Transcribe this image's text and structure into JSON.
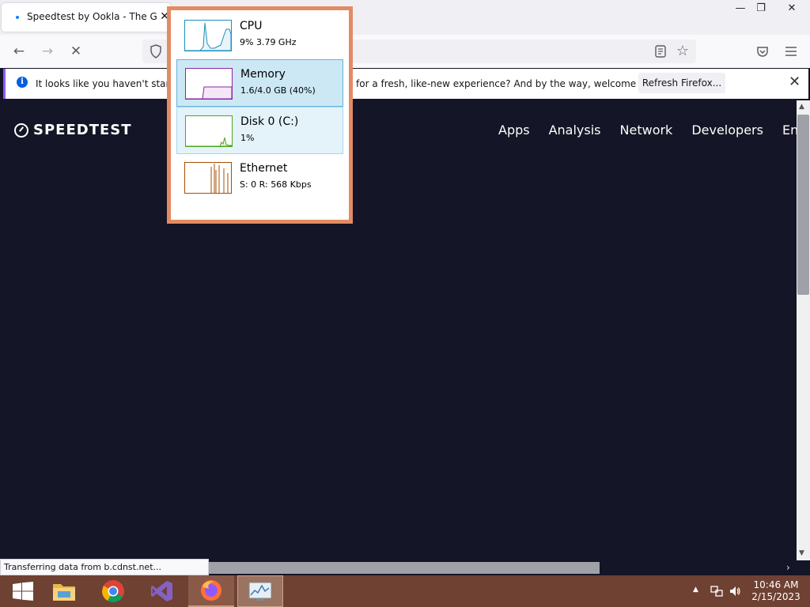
{
  "browser": {
    "tab": {
      "title": "Speedtest by Ookla - The Global Broadband Speed Test"
    },
    "notification": {
      "text_left": "It looks like you haven't started",
      "text_right": "for a fresh, like-new experience? And by the way, welcome back!",
      "button_label": "Refresh Firefox..."
    },
    "status_text": "Transferring data from b.cdnst.net..."
  },
  "site": {
    "logo_text": "SPEEDTEST",
    "nav": [
      "Apps",
      "Analysis",
      "Network",
      "Developers",
      "Ent"
    ]
  },
  "task_manager": {
    "items": [
      {
        "name": "CPU",
        "value": "9% 3.79 GHz",
        "color": "#1a8fbd"
      },
      {
        "name": "Memory",
        "value": "1.6/4.0 GB (40%)",
        "color": "#8b24a8"
      },
      {
        "name": "Disk 0 (C:)",
        "value": "1%",
        "color": "#4da71c"
      },
      {
        "name": "Ethernet",
        "value": "S: 0 R: 568 Kbps",
        "color": "#a74f01"
      }
    ]
  },
  "taskbar": {
    "apps": [
      "start-button",
      "file-explorer",
      "chrome",
      "visual-studio",
      "firefox",
      "task-manager"
    ],
    "clock": {
      "time": "10:46 AM",
      "date": "2/15/2023"
    }
  },
  "colors": {
    "page_background": "#141526",
    "taskbar": "#6e4133",
    "flyout_border": "#e38b63"
  }
}
